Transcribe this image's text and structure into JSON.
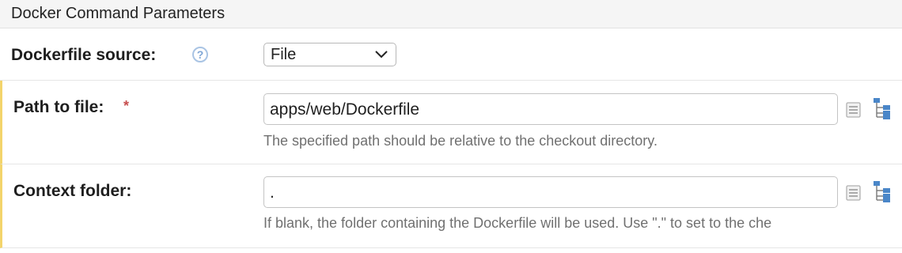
{
  "section": {
    "title": "Docker Command Parameters"
  },
  "dockerfile_source": {
    "label": "Dockerfile source:",
    "help_icon": "question-circle-icon",
    "selected": "File"
  },
  "path_to_file": {
    "label": "Path to file:",
    "required_marker": "*",
    "value": "apps/web/Dockerfile",
    "hint": "The specified path should be relative to the checkout directory.",
    "icons": [
      "text-editor-icon",
      "file-tree-icon"
    ]
  },
  "context_folder": {
    "label": "Context folder:",
    "value": ".",
    "hint": "If blank, the folder containing the Dockerfile will be used. Use \".\" to set to the che",
    "icons": [
      "text-editor-icon",
      "file-tree-icon"
    ]
  },
  "colors": {
    "required": "#c74e4e",
    "highlight_border": "#f3d46b",
    "help_icon": "#7fa6d6",
    "tree_icon": "#4a86c8"
  }
}
